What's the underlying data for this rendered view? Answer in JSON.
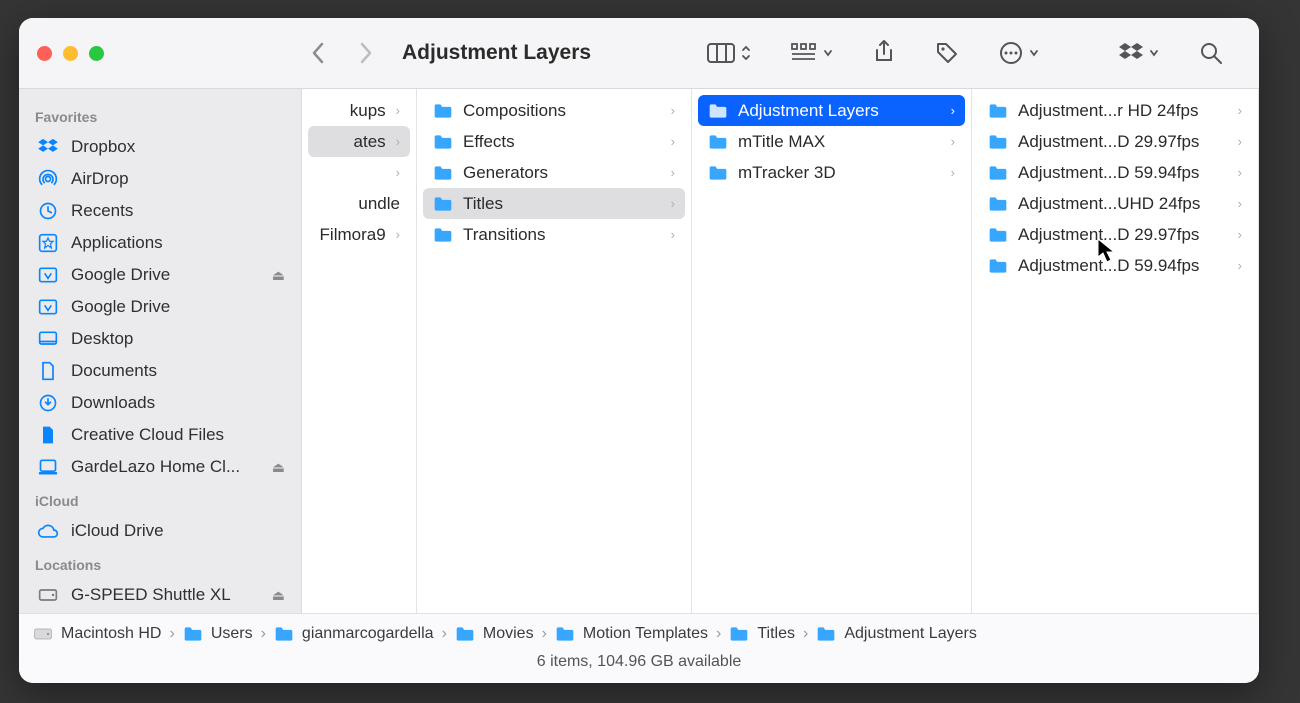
{
  "window_title": "Adjustment Layers",
  "sidebar": {
    "sections": [
      {
        "heading": "Favorites",
        "items": [
          {
            "label": "Dropbox",
            "icon": "dropbox",
            "eject": false
          },
          {
            "label": "AirDrop",
            "icon": "airdrop",
            "eject": false
          },
          {
            "label": "Recents",
            "icon": "clock",
            "eject": false
          },
          {
            "label": "Applications",
            "icon": "apps",
            "eject": false
          },
          {
            "label": "Google Drive",
            "icon": "gdrive",
            "eject": true
          },
          {
            "label": "Google Drive",
            "icon": "gdrive",
            "eject": false
          },
          {
            "label": "Desktop",
            "icon": "desktop",
            "eject": false
          },
          {
            "label": "Documents",
            "icon": "doc",
            "eject": false
          },
          {
            "label": "Downloads",
            "icon": "download",
            "eject": false
          },
          {
            "label": "Creative Cloud Files",
            "icon": "ccloud",
            "eject": false
          },
          {
            "label": "GardeLazo Home Cl...",
            "icon": "mac",
            "eject": true
          }
        ]
      },
      {
        "heading": "iCloud",
        "items": [
          {
            "label": "iCloud Drive",
            "icon": "icloud",
            "eject": false
          }
        ]
      },
      {
        "heading": "Locations",
        "items": [
          {
            "label": "G-SPEED Shuttle XL",
            "icon": "hdd",
            "eject": true
          }
        ]
      }
    ]
  },
  "columns": [
    {
      "items": [
        {
          "label": "kups",
          "arrow": true,
          "partial": true
        },
        {
          "label": "ates",
          "arrow": true,
          "partial": true,
          "selected": "grey"
        },
        {
          "label": "",
          "arrow": true,
          "partial": true
        },
        {
          "label": "undle",
          "arrow": false,
          "partial": true
        },
        {
          "label": "Filmora9",
          "arrow": true,
          "partial": true
        }
      ]
    },
    {
      "items": [
        {
          "label": "Compositions",
          "arrow": true
        },
        {
          "label": "Effects",
          "arrow": true
        },
        {
          "label": "Generators",
          "arrow": true
        },
        {
          "label": "Titles",
          "arrow": true,
          "selected": "grey"
        },
        {
          "label": "Transitions",
          "arrow": true
        }
      ]
    },
    {
      "items": [
        {
          "label": "Adjustment Layers",
          "arrow": true,
          "selected": "blue"
        },
        {
          "label": "mTitle MAX",
          "arrow": true
        },
        {
          "label": "mTracker 3D",
          "arrow": true
        }
      ]
    },
    {
      "items": [
        {
          "label": "Adjustment...r HD 24fps",
          "arrow": true
        },
        {
          "label": "Adjustment...D 29.97fps",
          "arrow": true
        },
        {
          "label": "Adjustment...D 59.94fps",
          "arrow": true
        },
        {
          "label": "Adjustment...UHD 24fps",
          "arrow": true
        },
        {
          "label": "Adjustment...D 29.97fps",
          "arrow": true
        },
        {
          "label": "Adjustment...D 59.94fps",
          "arrow": true
        }
      ]
    }
  ],
  "pathbar": [
    {
      "label": "Macintosh HD",
      "icon": "hdd"
    },
    {
      "label": "Users",
      "icon": "folder"
    },
    {
      "label": "gianmarcogardella",
      "icon": "folder"
    },
    {
      "label": "Movies",
      "icon": "folder"
    },
    {
      "label": "Motion Templates",
      "icon": "folder"
    },
    {
      "label": "Titles",
      "icon": "folder"
    },
    {
      "label": "Adjustment Layers",
      "icon": "folder"
    }
  ],
  "status": "6 items, 104.96 GB available"
}
